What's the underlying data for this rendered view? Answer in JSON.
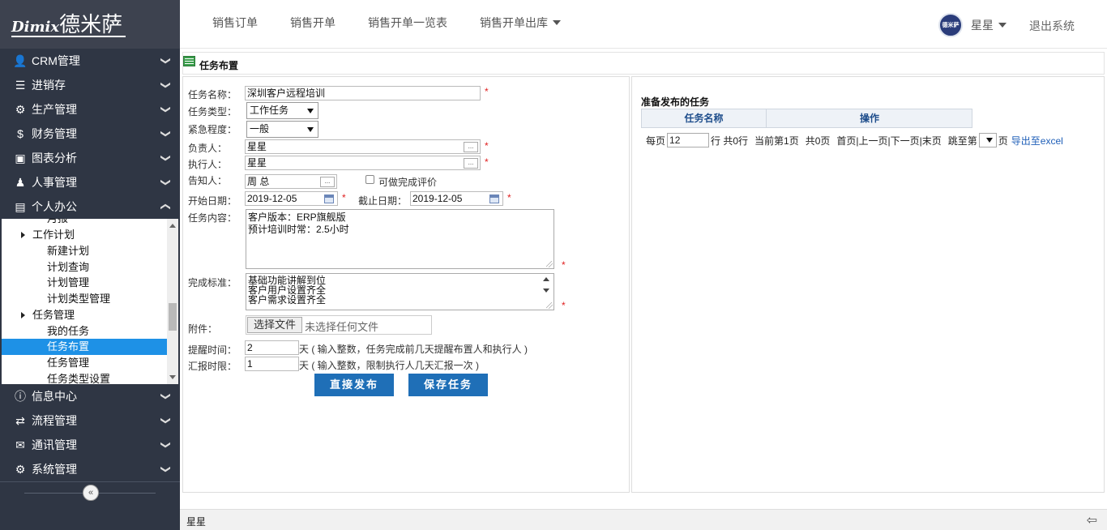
{
  "logo": {
    "en": "Dimix",
    "cn": "德米萨"
  },
  "top_nav": [
    {
      "label": "销售订单"
    },
    {
      "label": "销售开单"
    },
    {
      "label": "销售开单一览表"
    },
    {
      "label": "销售开单出库"
    }
  ],
  "user": {
    "avatar_text": "德米萨",
    "name": "星星",
    "logout": "退出系统"
  },
  "sidebar": {
    "menu": [
      {
        "label": "CRM管理",
        "icon": "user-icon"
      },
      {
        "label": "进销存",
        "icon": "list-icon"
      },
      {
        "label": "生产管理",
        "icon": "gears-icon"
      },
      {
        "label": "财务管理",
        "icon": "dollar-icon"
      },
      {
        "label": "图表分析",
        "icon": "picture-icon"
      },
      {
        "label": "人事管理",
        "icon": "users-icon"
      },
      {
        "label": "个人办公",
        "icon": "briefcase-icon"
      }
    ],
    "submenu": [
      {
        "label": "月报",
        "level": 2
      },
      {
        "label": "工作计划",
        "level": 1
      },
      {
        "label": "新建计划",
        "level": 2
      },
      {
        "label": "计划查询",
        "level": 2
      },
      {
        "label": "计划管理",
        "level": 2
      },
      {
        "label": "计划类型管理",
        "level": 2
      },
      {
        "label": "任务管理",
        "level": 1
      },
      {
        "label": "我的任务",
        "level": 2
      },
      {
        "label": "任务布置",
        "level": 2,
        "active": true
      },
      {
        "label": "任务管理",
        "level": 2
      },
      {
        "label": "任务类型设置",
        "level": 2
      }
    ],
    "menu_bottom": [
      {
        "label": "信息中心",
        "icon": "info-icon"
      },
      {
        "label": "流程管理",
        "icon": "exchange-icon"
      },
      {
        "label": "通讯管理",
        "icon": "comments-icon"
      },
      {
        "label": "系统管理",
        "icon": "gear-icon"
      }
    ],
    "collapse_glyph": "«"
  },
  "page": {
    "title": "任务布置"
  },
  "form": {
    "task_name_label": "任务名称：",
    "task_name": "深圳客户远程培训",
    "task_type_label": "任务类型：",
    "task_type": "工作任务",
    "urgency_label": "紧急程度：",
    "urgency": "一般",
    "owner_label": "负责人：",
    "owner": "星星",
    "executor_label": "执行人：",
    "executor": "星星",
    "notify_label": "告知人：",
    "notify": "周 总",
    "evaluate_label": "可做完成评价",
    "start_label": "开始日期：",
    "start_date": "2019-12-05",
    "end_label": "截止日期：",
    "end_date": "2019-12-05",
    "content_label": "任务内容：",
    "content": "客户版本：ERP旗舰版\n预计培训时常：2.5小时",
    "standard_label": "完成标准：",
    "standard": "基础功能讲解到位\n客户用户设置齐全\n客户需求设置齐全",
    "attach_label": "附件：",
    "file_button": "选择文件",
    "file_status": "未选择任何文件",
    "remind_label": "提醒时间：",
    "remind_value": "2",
    "remind_hint": "天 ( 输入整数，任务完成前几天提醒布置人和执行人 )",
    "report_label": "汇报时限：",
    "report_value": "1",
    "report_hint": "天 ( 输入整数，限制执行人几天汇报一次 )",
    "required_mark": "*",
    "dots": "...",
    "publish_button": "直接发布",
    "save_button": "保存任务"
  },
  "right": {
    "title": "准备发布的任务",
    "col_name": "任务名称",
    "col_ops": "操作",
    "per_page_label": "每页",
    "per_page": "12",
    "rows_text": "行 共0行",
    "current_text": "当前第1页",
    "total_text": "共0页",
    "nav_text": "首页|上一页|下一页|末页",
    "jump_label": "跳至第",
    "page_unit": "页",
    "export": "导出至excel"
  },
  "footer": {
    "user": "星星",
    "icon": "exit-icon"
  }
}
